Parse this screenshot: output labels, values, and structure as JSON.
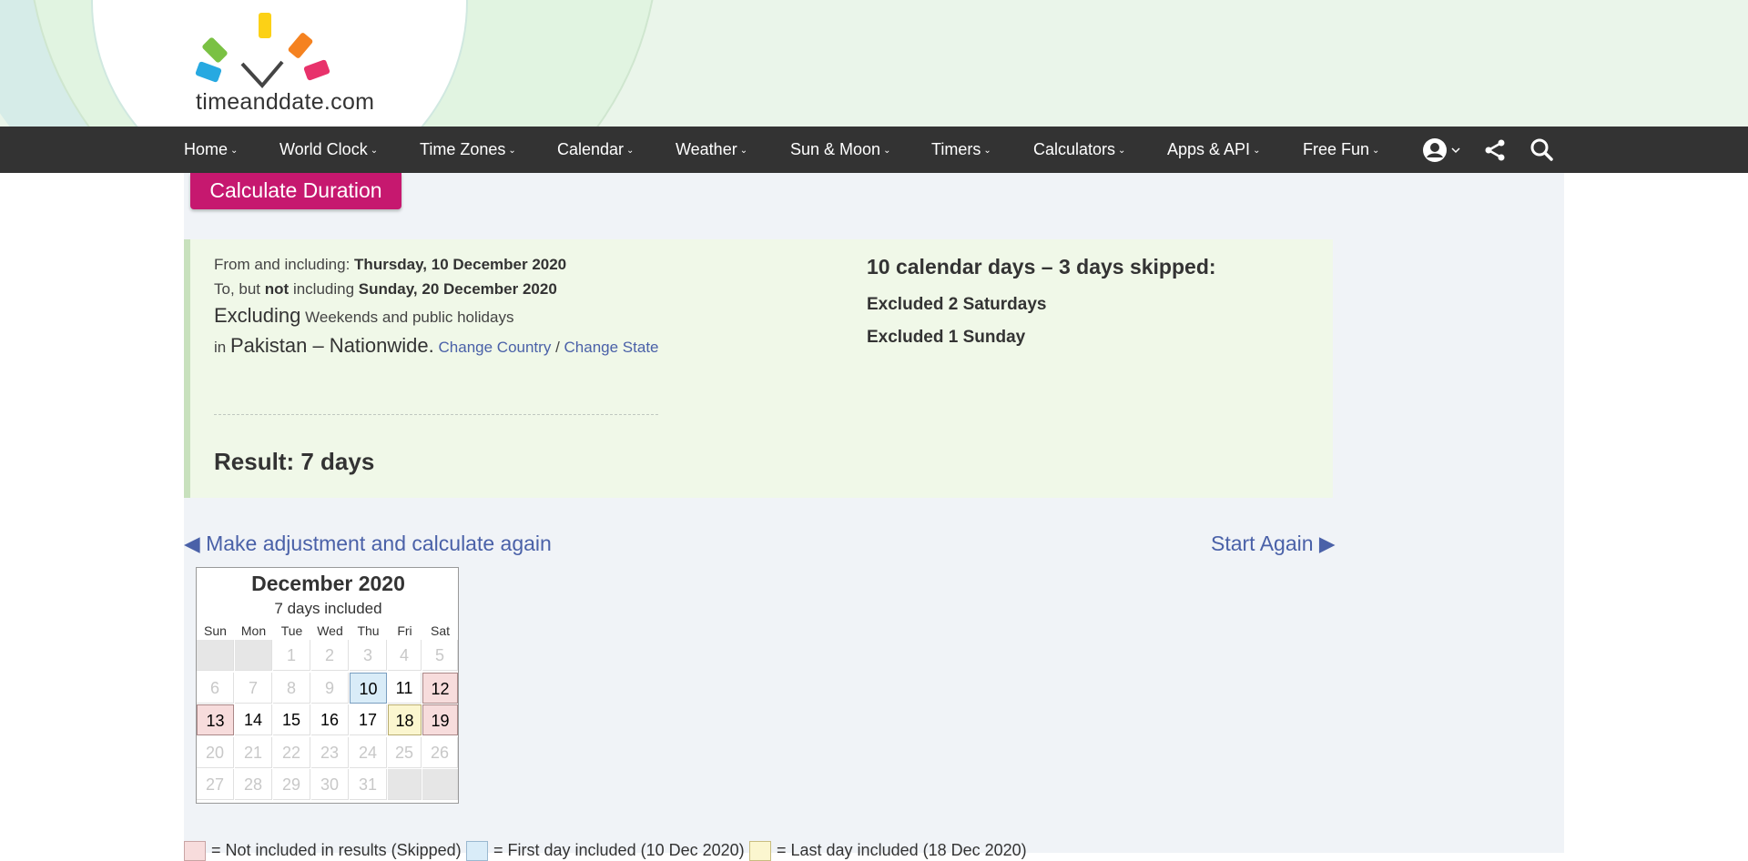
{
  "logo": {
    "text": "timeanddate.com"
  },
  "nav": {
    "items": [
      "Home",
      "World Clock",
      "Time Zones",
      "Calendar",
      "Weather",
      "Sun & Moon",
      "Timers",
      "Calculators",
      "Apps & API",
      "Free Fun"
    ],
    "chevron": "⌄",
    "icons": [
      "user-icon",
      "share-icon",
      "search-icon"
    ]
  },
  "calc_button": "Calculate Duration",
  "summary": {
    "from_label": "From and including:",
    "from_date": "Thursday, 10 December 2020",
    "to_prefix": "To, but",
    "to_not": "not",
    "to_label": "including",
    "to_date": "Sunday, 20 December 2020",
    "excluding": "Excluding",
    "excluding_what": "Weekends and public holidays",
    "in": "in",
    "country": "Pakistan – Nationwide",
    "change_country": "Change Country",
    "separator": "/",
    "change_state": "Change State",
    "result": "Result: 7 days",
    "right_title": "10 calendar days – 3 days skipped:",
    "excluded_saturdays": "Excluded 2 Saturdays",
    "excluded_sunday": "Excluded 1 Sunday"
  },
  "links": {
    "adjust": "◀ Make adjustment and calculate again",
    "start_again": "Start Again ▶"
  },
  "calendar": {
    "title": "December 2020",
    "subtitle": "7 days included",
    "dow": [
      "Sun",
      "Mon",
      "Tue",
      "Wed",
      "Thu",
      "Fri",
      "Sat"
    ],
    "weeks": [
      [
        {
          "d": "",
          "s": "blank"
        },
        {
          "d": "",
          "s": "blank"
        },
        {
          "d": "1",
          "s": "out"
        },
        {
          "d": "2",
          "s": "out"
        },
        {
          "d": "3",
          "s": "out"
        },
        {
          "d": "4",
          "s": "out"
        },
        {
          "d": "5",
          "s": "out"
        }
      ],
      [
        {
          "d": "6",
          "s": "out"
        },
        {
          "d": "7",
          "s": "out"
        },
        {
          "d": "8",
          "s": "out"
        },
        {
          "d": "9",
          "s": "out"
        },
        {
          "d": "10",
          "s": "first"
        },
        {
          "d": "11",
          "s": "in"
        },
        {
          "d": "12",
          "s": "skip"
        }
      ],
      [
        {
          "d": "13",
          "s": "skip"
        },
        {
          "d": "14",
          "s": "in"
        },
        {
          "d": "15",
          "s": "in"
        },
        {
          "d": "16",
          "s": "in"
        },
        {
          "d": "17",
          "s": "in"
        },
        {
          "d": "18",
          "s": "last"
        },
        {
          "d": "19",
          "s": "skip"
        }
      ],
      [
        {
          "d": "20",
          "s": "out"
        },
        {
          "d": "21",
          "s": "out"
        },
        {
          "d": "22",
          "s": "out"
        },
        {
          "d": "23",
          "s": "out"
        },
        {
          "d": "24",
          "s": "out"
        },
        {
          "d": "25",
          "s": "out"
        },
        {
          "d": "26",
          "s": "out"
        }
      ],
      [
        {
          "d": "27",
          "s": "out"
        },
        {
          "d": "28",
          "s": "out"
        },
        {
          "d": "29",
          "s": "out"
        },
        {
          "d": "30",
          "s": "out"
        },
        {
          "d": "31",
          "s": "out"
        },
        {
          "d": "",
          "s": "blank"
        },
        {
          "d": "",
          "s": "blank"
        }
      ]
    ]
  },
  "legend": {
    "skipped": "= Not included in results (Skipped)",
    "first": "= First day included (10 Dec 2020)",
    "last": "= Last day included (18 Dec 2020)"
  },
  "colors": {
    "nav_bg": "#333333",
    "button": "#c6186f",
    "link": "#4a61a8",
    "skip": "#f7dcdc",
    "first": "#d9ecf8",
    "last": "#fbf6cf"
  }
}
